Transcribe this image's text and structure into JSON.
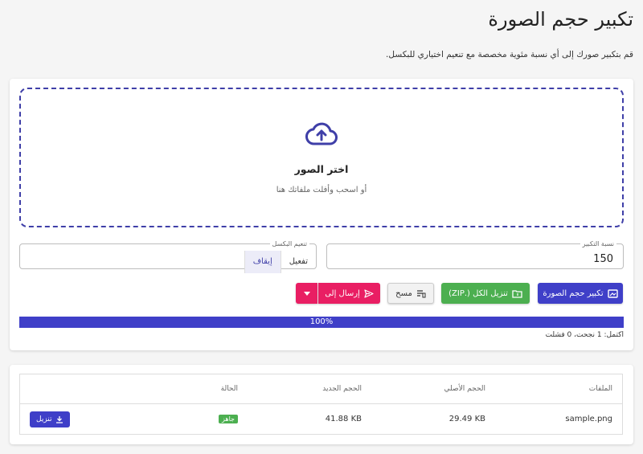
{
  "page": {
    "title": "تكبير حجم الصورة",
    "subtitle": "قم بتكبير صورك إلى أي نسبة مئوية مخصصة مع تنعيم اختياري للبكسل."
  },
  "dropzone": {
    "icon": "cloud-upload-icon",
    "title": "اختر الصور",
    "hint": "أو اسحب وأفلت ملفاتك هنا"
  },
  "controls": {
    "scale_label": "نسبة التكبير",
    "scale_value": "150",
    "pixel_label": "تنعيم البكسل",
    "pixel_options": [
      "تفعيل",
      "إيقاف"
    ],
    "pixel_selected": "إيقاف"
  },
  "actions": {
    "resize": "تكبير حجم الصورة",
    "download_all": "تنزيل الكل (.ZIP)",
    "clear": "مسح",
    "send_to": "إرسال إلى"
  },
  "progress": {
    "value": 100,
    "label": "100%",
    "status": "اكتمل: 1 نجحت، 0 فشلت"
  },
  "table": {
    "headers": [
      "الملفات",
      "الحجم الأصلي",
      "الحجم الجديد",
      "الحالة",
      ""
    ],
    "rows": [
      {
        "file": "sample.png",
        "original": "29.49 KB",
        "new": "41.88 KB",
        "status": "جاهز",
        "download": "تنزيل"
      }
    ]
  },
  "colors": {
    "primary": "#3f3fc8",
    "success": "#4caf50",
    "accent": "#e91e63"
  }
}
